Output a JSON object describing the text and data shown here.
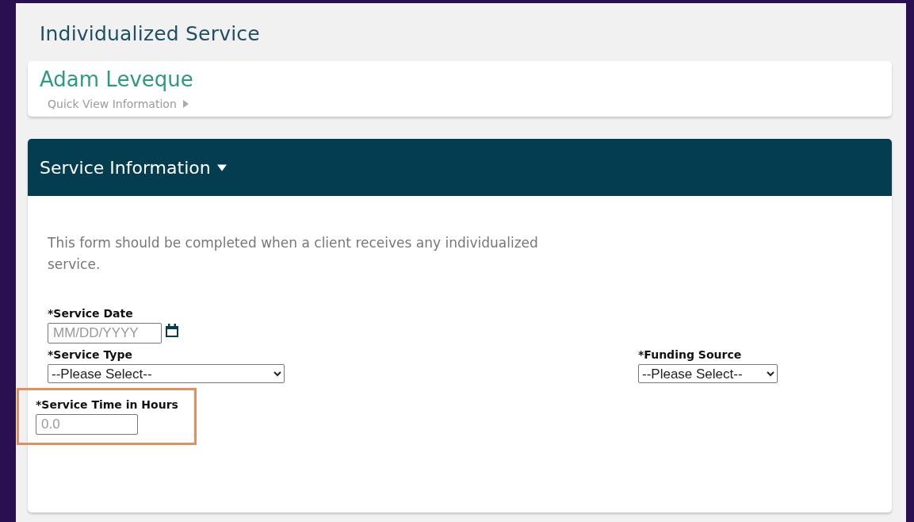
{
  "page": {
    "title": "Individualized Service"
  },
  "client": {
    "name": "Adam Leveque",
    "quick_view": {
      "label": "Quick View Information",
      "expanded": false
    }
  },
  "section": {
    "title": "Service Information",
    "expanded": true,
    "intro": "This form should be completed when a client receives any individualized service.",
    "fields": [
      {
        "kind": "date",
        "label": "*Service Date",
        "placeholder": "MM/DD/YYYY",
        "highlighted": false
      },
      {
        "kind": "select",
        "label": "*Service Type",
        "value": "--Please Select--",
        "highlighted": false
      },
      {
        "kind": "select",
        "label": "*Funding Source",
        "value": "--Please Select--",
        "highlighted": false
      },
      {
        "kind": "text",
        "label": "*Service Time in Hours",
        "placeholder": "0.0",
        "highlighted": true
      }
    ]
  }
}
